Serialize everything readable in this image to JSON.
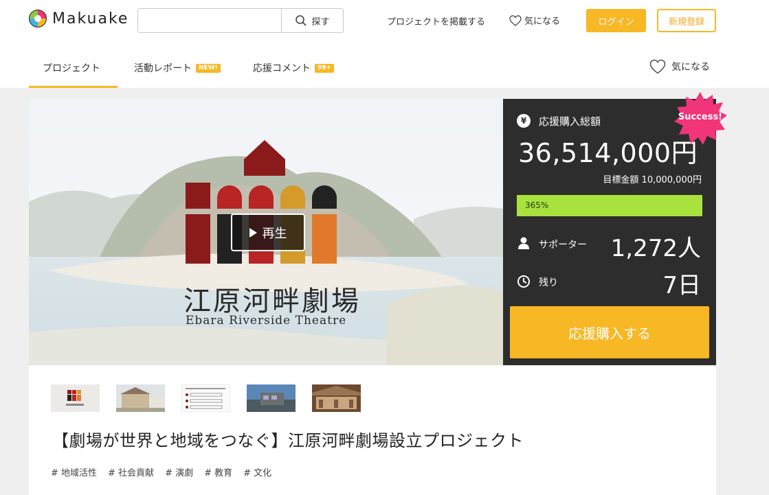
{
  "header": {
    "logo_text": "Makuake",
    "search": {
      "placeholder": "",
      "button_label": "探す"
    },
    "post_project_label": "プロジェクトを掲載する",
    "watch_label": "気になる",
    "login_label": "ログイン",
    "signup_label": "新規登録"
  },
  "tabs": {
    "items": [
      {
        "label": "プロジェクト",
        "badge": ""
      },
      {
        "label": "活動レポート",
        "badge": "NEW!"
      },
      {
        "label": "応援コメント",
        "badge": "99+"
      }
    ],
    "watch_label": "気になる"
  },
  "hero": {
    "play_label": "再生",
    "theatre_name_jp": "江原河畔劇場",
    "theatre_name_en": "Ebara Riverside Theatre"
  },
  "stats": {
    "total_label": "応援購入総額",
    "currency_icon": "¥",
    "total_amount": "36,514,000円",
    "goal": "目標金額 10,000,000円",
    "progress_text": "365%",
    "progress_fraction": 1.0,
    "supporters_label": "サポーター",
    "supporters_value": "1,272人",
    "remaining_label": "残り",
    "remaining_value": "7日",
    "cta_label": "応援購入する",
    "success_badge": "Success!"
  },
  "project": {
    "title": "【劇場が世界と地域をつなぐ】江原河畔劇場設立プロジェクト",
    "tags": [
      "# 地域活性",
      "# 社会貢献",
      "# 演劇",
      "# 教育",
      "# 文化"
    ]
  },
  "colors": {
    "accent": "#f8b724",
    "panel": "#2d2d2d",
    "progress": "#a9e23c",
    "success": "#f2347a"
  }
}
